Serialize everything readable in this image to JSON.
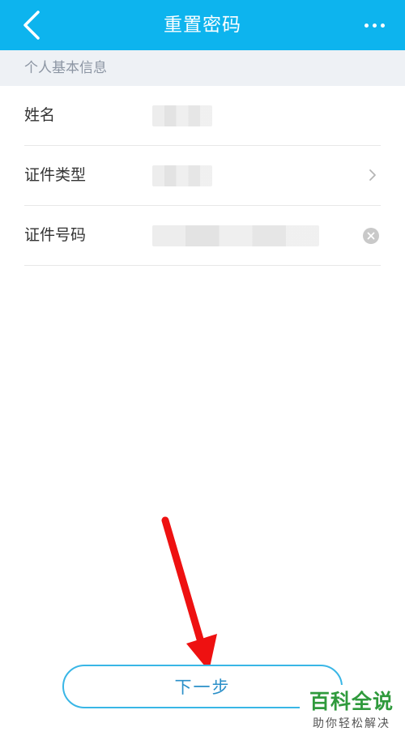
{
  "header": {
    "title": "重置密码",
    "back_icon": "chevron-left-icon",
    "more_icon": "more-horizontal-icon",
    "background_color": "#0db4ee"
  },
  "section": {
    "title": "个人基本信息"
  },
  "form": {
    "fields": [
      {
        "label": "姓名",
        "value": "",
        "control_icon": null
      },
      {
        "label": "证件类型",
        "value": "",
        "control_icon": "chevron-right-icon"
      },
      {
        "label": "证件号码",
        "value": "",
        "control_icon": "clear-icon"
      }
    ]
  },
  "actions": {
    "next_label": "下一步",
    "accent_color": "#39b6e6"
  },
  "watermark": {
    "main": "百科全说",
    "sub": "助你轻松解决"
  }
}
